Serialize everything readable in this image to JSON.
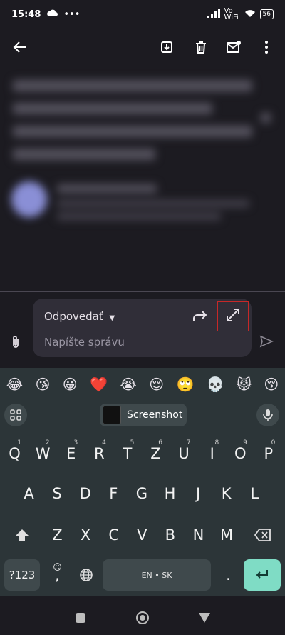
{
  "status_bar": {
    "time": "15:48",
    "battery": "56",
    "network_label": "Vo WiFi"
  },
  "compose": {
    "reply_label": "Odpovedať",
    "message_placeholder": "Napíšte správu"
  },
  "emoji_row": [
    "😂",
    "😘",
    "😀",
    "❤️",
    "😭",
    "😌",
    "🙄",
    "💀",
    "😾",
    "😚"
  ],
  "suggestion": {
    "label": "Screenshot"
  },
  "keyboard": {
    "row1": [
      {
        "k": "Q",
        "h": "1"
      },
      {
        "k": "W",
        "h": "2"
      },
      {
        "k": "E",
        "h": "3"
      },
      {
        "k": "R",
        "h": "4"
      },
      {
        "k": "T",
        "h": "5"
      },
      {
        "k": "Z",
        "h": "6"
      },
      {
        "k": "U",
        "h": "7"
      },
      {
        "k": "I",
        "h": "8"
      },
      {
        "k": "O",
        "h": "9"
      },
      {
        "k": "P",
        "h": "0"
      }
    ],
    "row2": [
      "A",
      "S",
      "D",
      "F",
      "G",
      "H",
      "J",
      "K",
      "L"
    ],
    "row3": [
      "Z",
      "X",
      "C",
      "V",
      "B",
      "N",
      "M"
    ],
    "symbols_label": "?123",
    "comma_label": ",",
    "period_label": ".",
    "space_label": "EN • SK"
  }
}
